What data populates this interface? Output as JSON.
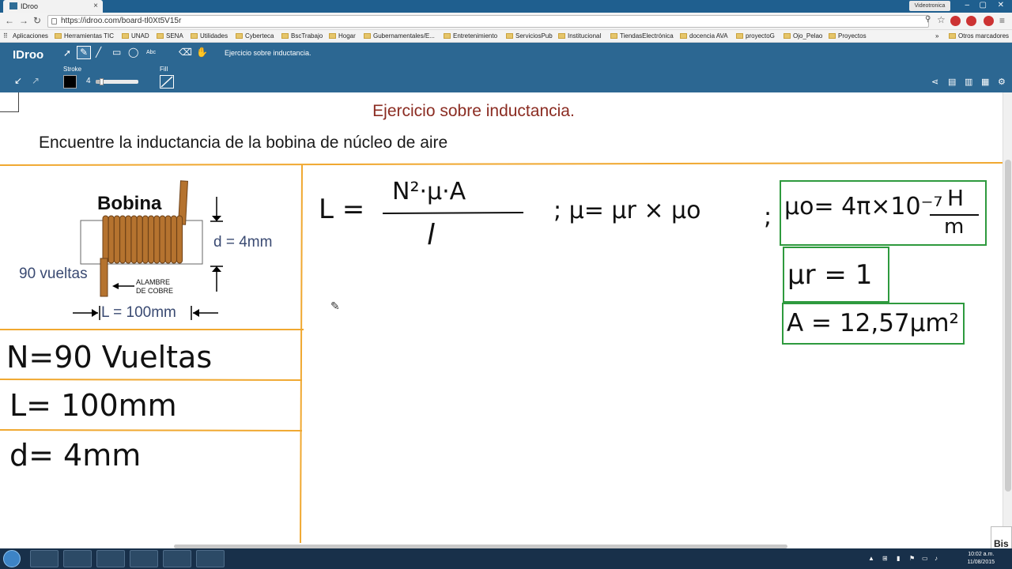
{
  "browser": {
    "tab_title": "IDroo",
    "tab_close": "×",
    "user_badge": "Videotronica",
    "url": "https://idroo.com/board-tl0Xt5V15r",
    "bookmarks": [
      "Aplicaciones",
      "Herramientas TIC",
      "UNAD",
      "SENA",
      "Utilidades",
      "Cyberteca",
      "BscTrabajo",
      "Hogar",
      "Gubernamentales/E...",
      "Entretenimiento",
      "ServiciosPub",
      "Institucional",
      "TiendasElectrónica",
      "docencia AVA",
      "proyectoG",
      "Ojo_Pelao",
      "Proyectos"
    ],
    "bookmarks_overflow": "»",
    "other_bookmarks": "Otros marcadores"
  },
  "toolbar": {
    "logo": "IDroo",
    "board_name": "Ejercicio sobre inductancia.",
    "text_tool": "Abc",
    "stroke_label": "Stroke",
    "stroke_width": "4",
    "stroke_slider_fraction": 0.1,
    "stroke_color": "#000000",
    "fill_label": "Fill"
  },
  "board": {
    "title": "Ejercicio sobre inductancia.",
    "subtitle": "Encuentre la inductancia de la bobina de núcleo de aire",
    "diagram": {
      "heading": "Bobina",
      "diameter": "d = 4mm",
      "turns": "90 vueltas",
      "wire_line1": "ALAMBRE",
      "wire_line2": "DE COBRE",
      "length": "L = 100mm"
    },
    "given": [
      "N=90 Vueltas",
      "L= 100mm",
      "d= 4mm"
    ],
    "formula": {
      "lhs": "L =",
      "numerator": "N²·μ·A",
      "denominator": "l",
      "mu_def": "; μ= μr × μo",
      "sep": ";"
    },
    "boxes": {
      "mu0": "μo= 4π×10⁻⁷",
      "mu0_unit_num": "H",
      "mu0_unit_den": "m",
      "mur": "μr = 1",
      "area": "A = 12,57μm²"
    },
    "edge_char": "9"
  },
  "corner_label": "Bis",
  "taskbar": {
    "time": "10:02 a.m.",
    "date": "11/08/2015"
  },
  "colors": {
    "toolbar_bg": "#2c6792",
    "title_color": "#8b2c22",
    "grid_line": "#f0a830",
    "box_border": "#2e9a3e",
    "coil_copper": "#b5732f"
  }
}
